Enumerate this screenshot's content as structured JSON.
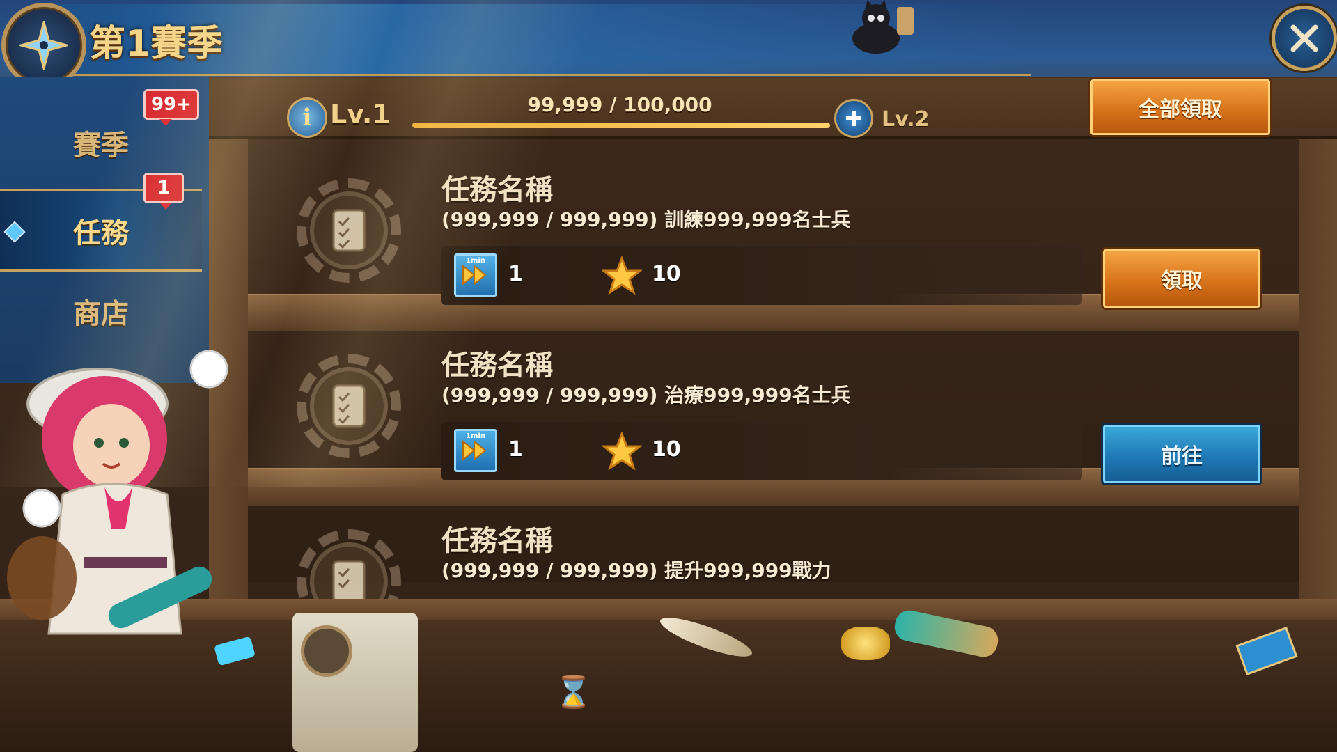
{
  "header": {
    "title": "第1賽季",
    "emblem_icon": "compass-star-icon",
    "close_icon": "close-icon"
  },
  "sidebar": {
    "items": [
      {
        "label": "賽季",
        "badge": "99+",
        "selected": false
      },
      {
        "label": "任務",
        "badge": "1",
        "selected": true
      },
      {
        "label": "商店",
        "badge": "",
        "selected": false
      }
    ]
  },
  "level": {
    "current": "Lv.1",
    "next": "Lv.2",
    "xp_text": "99,999 / 100,000",
    "xp_progress": 0.99999,
    "info_icon": "info-icon",
    "add_icon": "plus-icon"
  },
  "claim_all_label": "全部領取",
  "tasks": [
    {
      "name": "任務名稱",
      "desc": "(999,999 / 999,999) 訓練999,999名士兵",
      "speedup_tag": "1min",
      "speedup_count": "1",
      "star_count": "10",
      "button_label": "領取",
      "button_style": "orange"
    },
    {
      "name": "任務名稱",
      "desc": "(999,999 / 999,999) 治療999,999名士兵",
      "speedup_tag": "1min",
      "speedup_count": "1",
      "star_count": "10",
      "button_label": "前往",
      "button_style": "blue"
    },
    {
      "name": "任務名稱",
      "desc": "(999,999 / 999,999) 提升999,999戰力"
    }
  ],
  "colors": {
    "gold_text": "#f4d489",
    "orange_button": "#d8741a",
    "blue_button": "#1f79b5",
    "badge_red": "#d8242e",
    "panel_blue": "#1f4a7c",
    "wood": "#4a321f"
  }
}
